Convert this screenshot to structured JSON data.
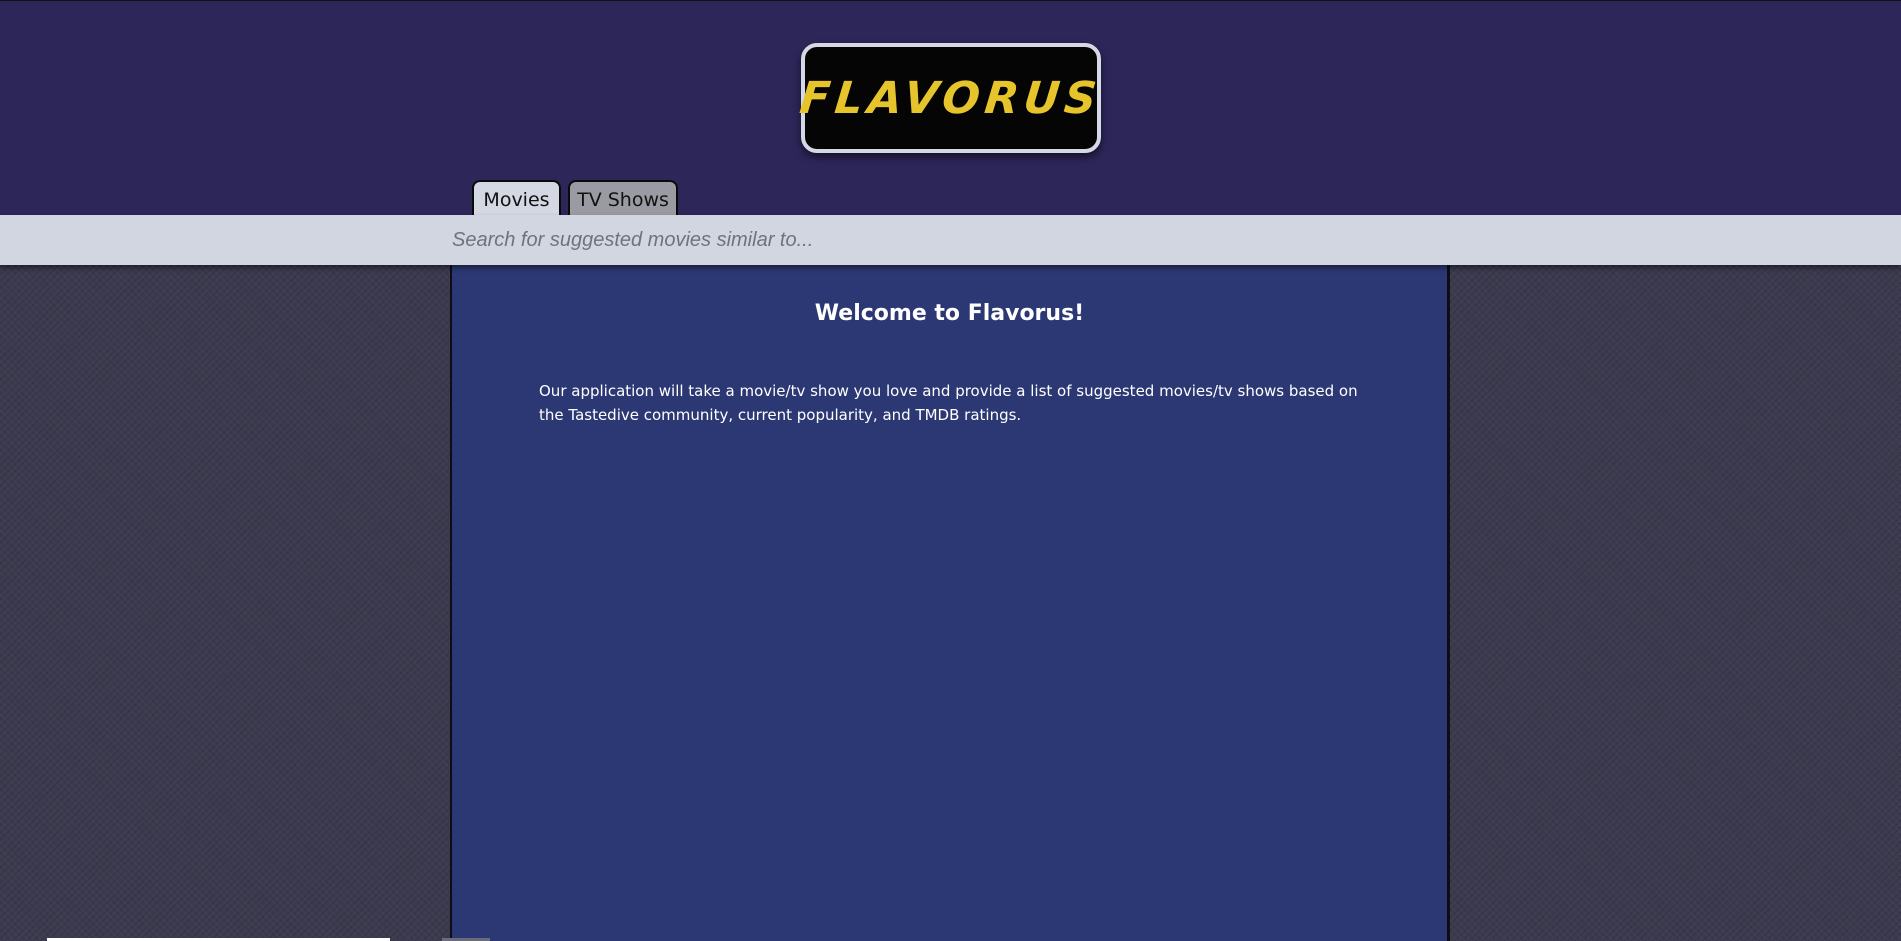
{
  "header": {
    "logo_text": "FLAVORUS",
    "colors": {
      "header_bg": "#2d2659",
      "logo_text": "#e6c52c",
      "logo_bg": "#050505"
    }
  },
  "tabs": [
    {
      "label": "Movies",
      "active": true
    },
    {
      "label": "TV Shows",
      "active": false
    }
  ],
  "search": {
    "placeholder": "Search for suggested movies similar to...",
    "value": ""
  },
  "main": {
    "title": "Welcome to Flavorus!",
    "description": "Our application will take a movie/tv show you love and provide a list of suggested movies/tv shows based on the Tastedive community, current popularity, and TMDB ratings.",
    "colors": {
      "panel_bg": "#2c3873",
      "text": "#ffffff"
    }
  }
}
